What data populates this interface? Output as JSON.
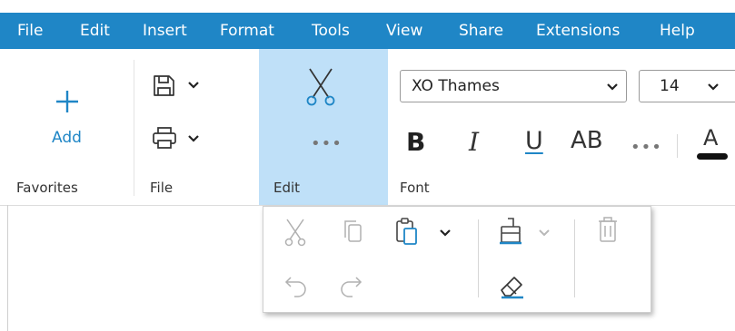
{
  "menu": [
    "File",
    "Edit",
    "Insert",
    "Format",
    "Tools",
    "View",
    "Share",
    "Extensions",
    "Help"
  ],
  "ribbon": {
    "favorites": {
      "label": "Favorites",
      "add_label": "Add"
    },
    "file": {
      "label": "File"
    },
    "edit": {
      "label": "Edit",
      "more": "•••"
    },
    "font": {
      "label": "Font",
      "family": "XO Thames",
      "size": "14",
      "bold": "B",
      "italic": "I",
      "underline": "U",
      "caps": "AB",
      "more": "•••",
      "color_glyph": "A"
    }
  },
  "colors": {
    "menubar": "#1f86c6",
    "accent": "#1f86c6",
    "edit_group_bg": "#bfe0f8"
  }
}
